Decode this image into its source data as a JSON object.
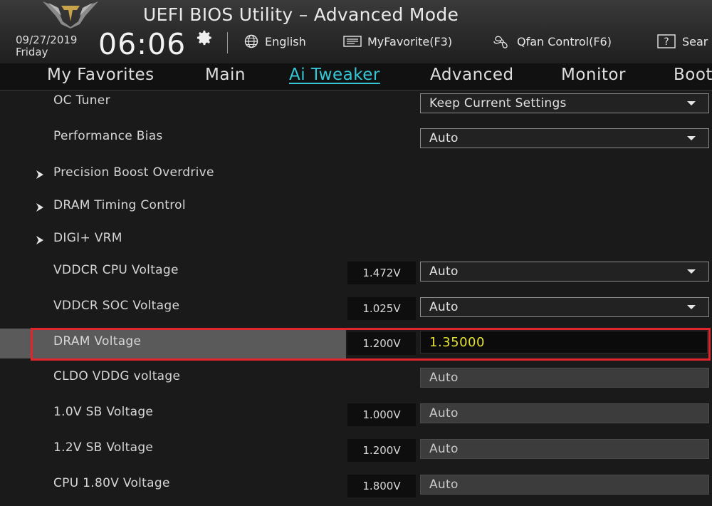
{
  "header": {
    "title": "UEFI BIOS Utility – Advanced Mode",
    "date": "09/27/2019",
    "day": "Friday",
    "time": "06:06",
    "language": "English",
    "favorite": "MyFavorite(F3)",
    "qfan": "Qfan Control(F6)",
    "search": "Sear"
  },
  "tabs": [
    {
      "label": "My Favorites"
    },
    {
      "label": "Main"
    },
    {
      "label": "Ai Tweaker"
    },
    {
      "label": "Advanced"
    },
    {
      "label": "Monitor"
    },
    {
      "label": "Boot"
    }
  ],
  "active_tab": "Ai Tweaker",
  "colors": {
    "accent": "#35c7d6",
    "highlight_border": "#e0262b",
    "input_value": "#e5e22f"
  },
  "rows": {
    "oc_tuner": {
      "label": "OC Tuner",
      "value": "Keep Current Settings"
    },
    "performance_bias": {
      "label": "Performance Bias",
      "value": "Auto"
    },
    "pbo": {
      "label": "Precision Boost Overdrive"
    },
    "dram_timing": {
      "label": "DRAM Timing Control"
    },
    "digi_vrm": {
      "label": "DIGI+ VRM"
    },
    "vddcr_cpu": {
      "label": "VDDCR CPU Voltage",
      "current": "1.472V",
      "value": "Auto"
    },
    "vddcr_soc": {
      "label": "VDDCR SOC Voltage",
      "current": "1.025V",
      "value": "Auto"
    },
    "dram_voltage": {
      "label": "DRAM Voltage",
      "current": "1.200V",
      "value": "1.35000"
    },
    "cldo_vddg": {
      "label": "CLDO VDDG voltage",
      "value": "Auto"
    },
    "sb_1_0v": {
      "label": "1.0V SB Voltage",
      "current": "1.000V",
      "value": "Auto"
    },
    "sb_1_2v": {
      "label": "1.2V SB Voltage",
      "current": "1.200V",
      "value": "Auto"
    },
    "cpu_1_80v": {
      "label": "CPU 1.80V Voltage",
      "current": "1.800V",
      "value": "Auto"
    }
  }
}
